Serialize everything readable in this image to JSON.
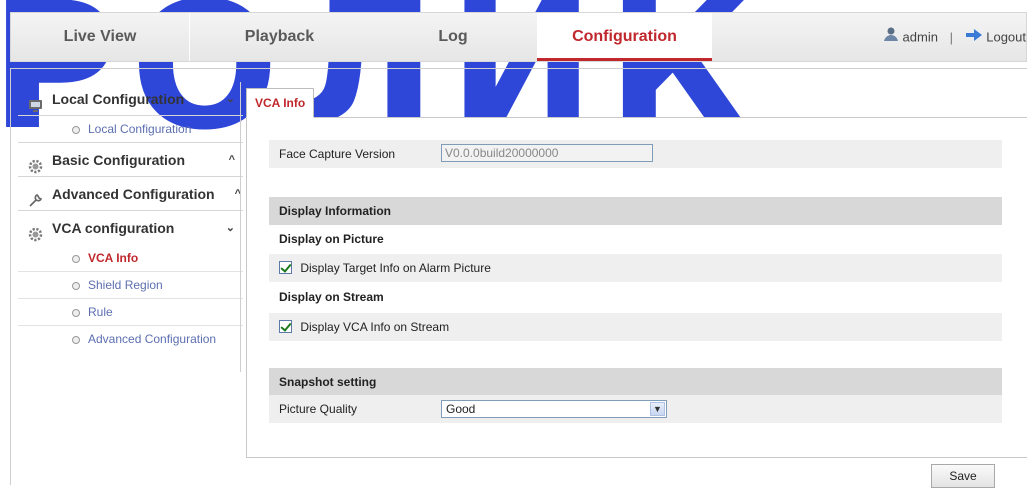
{
  "watermark": "РОЛИК",
  "nav": {
    "tabs": [
      {
        "label": "Live View"
      },
      {
        "label": "Playback"
      },
      {
        "label": "Log"
      },
      {
        "label": "Configuration"
      }
    ],
    "user": "admin",
    "separator": "|",
    "logout": "Logout"
  },
  "sidebar": {
    "groups": [
      {
        "label": "Local Configuration",
        "chevron": "⌄",
        "icon": "monitor-icon",
        "items": [
          {
            "label": "Local Configuration"
          }
        ]
      },
      {
        "label": "Basic Configuration",
        "chevron": "^",
        "icon": "gear-icon",
        "items": []
      },
      {
        "label": "Advanced Configuration",
        "chevron": "^",
        "icon": "wrench-icon",
        "items": []
      },
      {
        "label": "VCA configuration",
        "chevron": "⌄",
        "icon": "gear-icon",
        "items": [
          {
            "label": "VCA Info",
            "active": true
          },
          {
            "label": "Shield Region"
          },
          {
            "label": "Rule"
          },
          {
            "label": "Advanced Configuration"
          }
        ]
      }
    ]
  },
  "content": {
    "tab": "VCA Info",
    "face_capture": {
      "label": "Face Capture Version",
      "value": "V0.0.0build20000000"
    },
    "display_info": {
      "heading": "Display Information",
      "on_picture": "Display on Picture",
      "target_info": {
        "label": "Display Target Info on Alarm Picture",
        "checked": true
      },
      "on_stream": "Display on Stream",
      "vca_info": {
        "label": "Display VCA Info on Stream",
        "checked": true
      }
    },
    "snapshot": {
      "heading": "Snapshot setting",
      "quality_label": "Picture Quality",
      "quality_value": "Good"
    },
    "save": "Save"
  },
  "colors": {
    "accent": "#c0282d",
    "link": "#5c6fb0",
    "watermark": "#2f47d9"
  }
}
